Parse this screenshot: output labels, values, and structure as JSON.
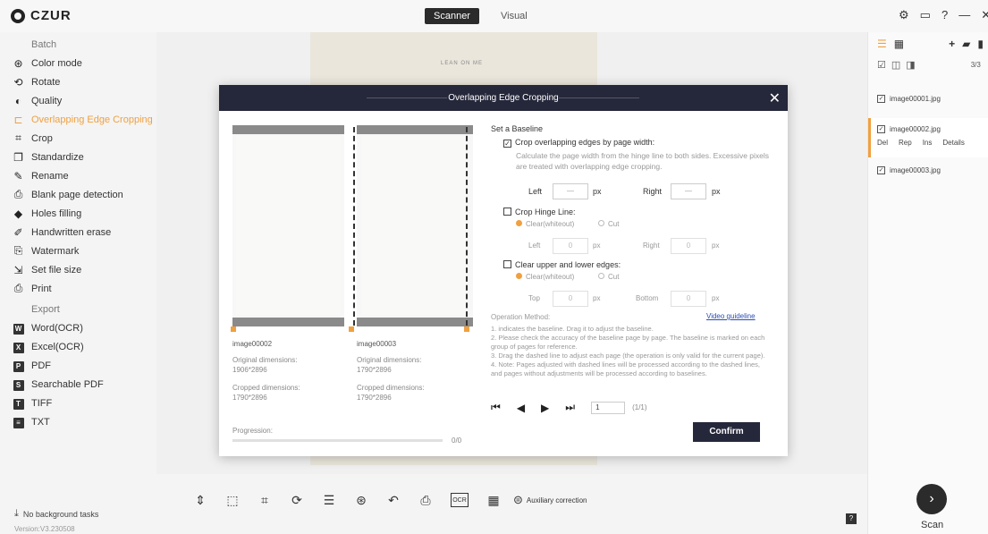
{
  "app": {
    "logo": "CZUR",
    "mode_tabs": [
      "Scanner",
      "Visual"
    ],
    "win_controls": [
      "⚙",
      "▭",
      "?",
      "—",
      "✕"
    ]
  },
  "sidebar": {
    "batch_label": "Batch",
    "batch_items": [
      {
        "label": "Color mode",
        "icon": "color-mode-icon",
        "glyph": "⊛"
      },
      {
        "label": "Rotate",
        "icon": "rotate-icon",
        "glyph": "⟲"
      },
      {
        "label": "Quality",
        "icon": "quality-icon",
        "glyph": "◐"
      },
      {
        "label": "Overlapping Edge Cropping",
        "icon": "overlap-crop-icon",
        "glyph": "⊏",
        "active": true
      },
      {
        "label": "Crop",
        "icon": "crop-icon",
        "glyph": "⌗"
      },
      {
        "label": "Standardize",
        "icon": "standardize-icon",
        "glyph": "❐"
      },
      {
        "label": "Rename",
        "icon": "rename-icon",
        "glyph": "✎"
      },
      {
        "label": "Blank page detection",
        "icon": "blank-page-icon",
        "glyph": "⎙"
      },
      {
        "label": "Holes filling",
        "icon": "holes-filling-icon",
        "glyph": "◆"
      },
      {
        "label": "Handwritten erase",
        "icon": "handwritten-erase-icon",
        "glyph": "✐"
      },
      {
        "label": "Watermark",
        "icon": "watermark-icon",
        "glyph": "⎘"
      },
      {
        "label": "Set file size",
        "icon": "file-size-icon",
        "glyph": "⇲"
      },
      {
        "label": "Print",
        "icon": "print-icon",
        "glyph": "⎙"
      }
    ],
    "export_label": "Export",
    "export_items": [
      {
        "label": "Word(OCR)",
        "icon": "word-icon",
        "glyph": "W"
      },
      {
        "label": "Excel(OCR)",
        "icon": "excel-icon",
        "glyph": "X"
      },
      {
        "label": "PDF",
        "icon": "pdf-icon",
        "glyph": "P"
      },
      {
        "label": "Searchable PDF",
        "icon": "searchable-pdf-icon",
        "glyph": "S"
      },
      {
        "label": "TIFF",
        "icon": "tiff-icon",
        "glyph": "T"
      },
      {
        "label": "TXT",
        "icon": "txt-icon",
        "glyph": "≡"
      }
    ],
    "tasks_status": "No background tasks",
    "version": "Version:V3.230508"
  },
  "canvas": {
    "page_header": "LEAN ON ME"
  },
  "bottom_toolbar": {
    "tools": [
      {
        "name": "fit-icon",
        "glyph": "⇕"
      },
      {
        "name": "select-icon",
        "glyph": "⬚"
      },
      {
        "name": "crop-tool-icon",
        "glyph": "⌗"
      },
      {
        "name": "rotate-tool-icon",
        "glyph": "⟳"
      },
      {
        "name": "adjust-icon",
        "glyph": "☰"
      },
      {
        "name": "color-tool-icon",
        "glyph": "⊛"
      },
      {
        "name": "undo-icon",
        "glyph": "↶"
      },
      {
        "name": "print-tool-icon",
        "glyph": "⎙"
      },
      {
        "name": "ocr-icon",
        "glyph": "OCR"
      },
      {
        "name": "qr-icon",
        "glyph": "▦"
      }
    ],
    "auxiliary_label": "Auxiliary correction"
  },
  "right_panel": {
    "count": "3/3",
    "files": [
      {
        "name": "image00001.jpg"
      },
      {
        "name": "image00002.jpg",
        "selected": true,
        "actions": [
          "Del",
          "Rep",
          "Ins",
          "Details"
        ]
      },
      {
        "name": "image00003.jpg"
      }
    ],
    "scan_label": "Scan"
  },
  "modal": {
    "title": "Overlapping Edge Cropping",
    "left_image": {
      "name": "image00002",
      "orig_label": "Original dimensions:",
      "orig": "1906*2896",
      "crop_label": "Cropped dimensions:",
      "crop": "1790*2896"
    },
    "right_image": {
      "name": "image00003",
      "orig_label": "Original dimensions:",
      "orig": "1790*2896",
      "crop_label": "Cropped dimensions:",
      "crop": "1790*2896"
    },
    "progression_label": "Progression:",
    "progression_value": "0/0",
    "baseline_label": "Set a Baseline",
    "opt1_label": "Crop overlapping edges by page width:",
    "opt1_desc": "Calculate the page width from the hinge line to both sides. Excessive pixels are treated with overlapping edge cropping.",
    "left_label": "Left",
    "right_label": "Right",
    "top_label": "Top",
    "bottom_label": "Bottom",
    "px": "px",
    "dash_value": "—",
    "zero_value": "0",
    "opt2_label": "Crop Hinge Line:",
    "opt3_label": "Clear upper and lower edges:",
    "radio_clear": "Clear(whiteout)",
    "radio_cut": "Cut",
    "op_method": "Operation Method:",
    "video_guideline": "Video guideline",
    "note1": "1.  indicates the baseline. Drag it to adjust the baseline.",
    "note2": "2. Please check the accuracy of the baseline page by page. The baseline is marked on each group of pages for reference.",
    "note3": "3. Drag the dashed line to adjust each page (the operation is only valid for the current page).",
    "note4": "4. Note: Pages adjusted with dashed lines will be processed according to the dashed lines, and pages without adjustments will be processed according to baselines.",
    "page_input": "1",
    "page_total": "(1/1)",
    "confirm_label": "Confirm"
  }
}
